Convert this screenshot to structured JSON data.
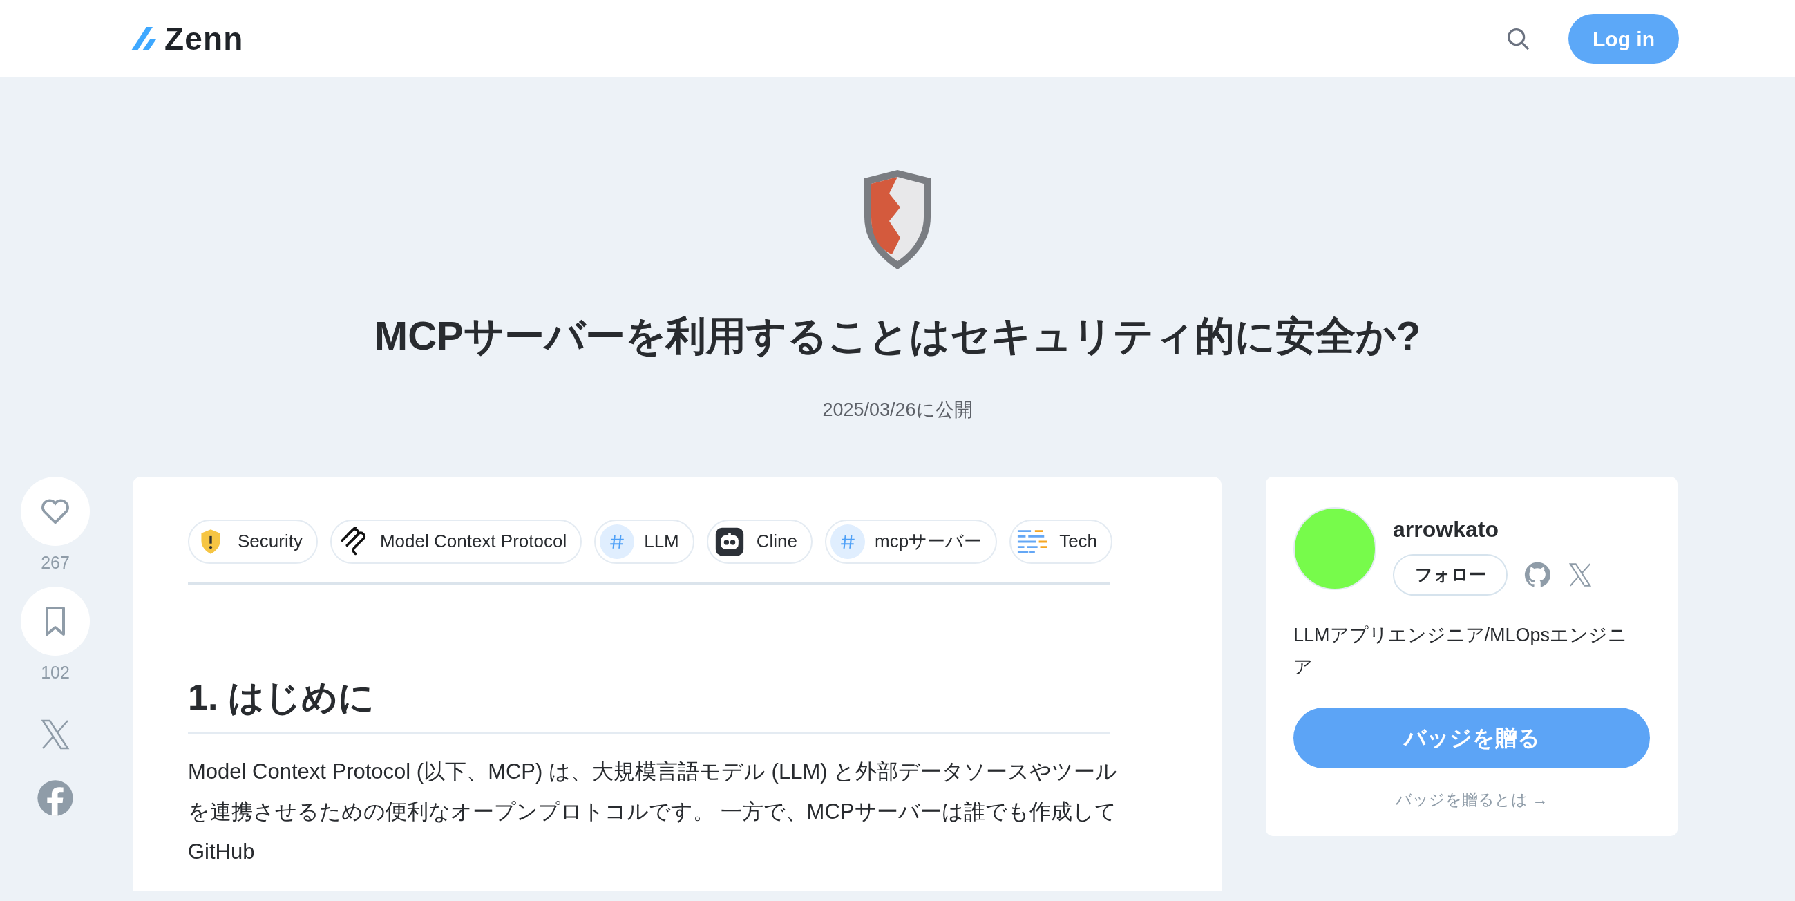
{
  "header": {
    "logo": "Zenn",
    "login": "Log in"
  },
  "article": {
    "title": "MCPサーバーを利用することはセキュリティ的に安全か?",
    "date": "2025/03/26に公開",
    "tags": [
      {
        "kind": "image",
        "label": "Security"
      },
      {
        "kind": "image",
        "label": "Model Context Protocol"
      },
      {
        "kind": "hash",
        "label": "LLM"
      },
      {
        "kind": "image",
        "label": "Cline"
      },
      {
        "kind": "hash",
        "label": "mcpサーバー"
      },
      {
        "kind": "image",
        "label": "Tech"
      }
    ],
    "heading": "1. はじめに",
    "paragraph": "Model Context Protocol (以下、MCP) は、大規模言語モデル (LLM) と外部データソースやツールを連携させるための便利なオープンプロトコルです。 一方で、MCPサーバーは誰でも作成してGitHub"
  },
  "actions": {
    "likes": "267",
    "bookmarks": "102"
  },
  "author": {
    "name": "arrowkato",
    "follow": "フォロー",
    "bio": "LLMアプリエンジニア/MLOpsエンジニア",
    "badge_button": "バッジを贈る",
    "badge_link": "バッジを贈るとは →"
  }
}
